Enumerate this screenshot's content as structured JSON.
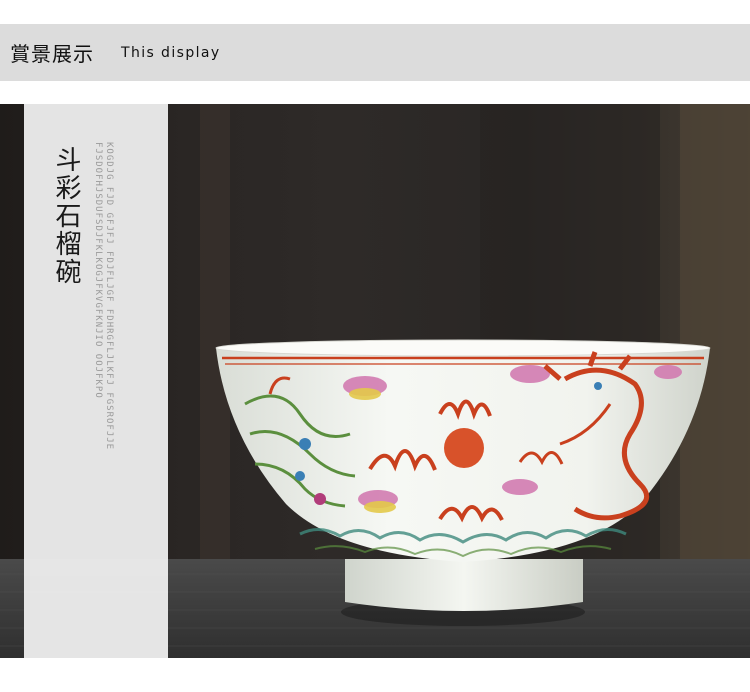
{
  "header": {
    "title_cn": "賞景展示",
    "title_en": "This display"
  },
  "panel": {
    "title": "斗彩石榴碗",
    "subtitle_lines": [
      "KOGDJG FJD GFJFJ FDJFLJGF FDHRGFLJLKFJ FGSROFJJE",
      "FJSDOFHJSDUFSDJFKLKOGJFKVGFKNJIO OOJFKPO"
    ]
  },
  "image": {
    "subject": "doucai bowl with dragon and phoenix decoration",
    "colors": {
      "glaze": "#f4f6f2",
      "red": "#c9401e",
      "green": "#5b8f3e",
      "table": "#3b3b3b"
    }
  }
}
